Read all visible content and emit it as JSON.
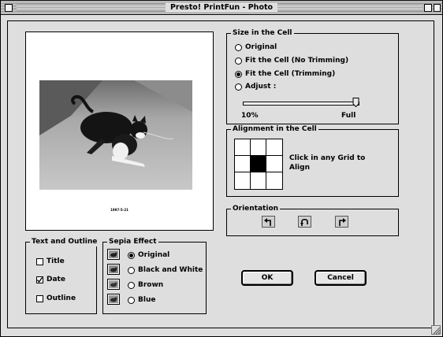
{
  "window": {
    "title": "Presto! PrintFun - Photo"
  },
  "preview": {
    "caption": "1997-5-21"
  },
  "size_in_cell": {
    "legend": "Size in the Cell",
    "options": [
      "Original",
      "Fit the Cell  (No Trimming)",
      "Fit the Cell  (Trimming)",
      "Adjust :"
    ],
    "selected": "Fit the Cell  (Trimming)",
    "slider": {
      "min_label": "10%",
      "max_label": "Full",
      "value_fraction": 1.0
    }
  },
  "alignment": {
    "legend": "Alignment in the Cell",
    "hint": "Click in any Grid to Align",
    "selected_cell": "center"
  },
  "orientation": {
    "legend": "Orientation",
    "buttons": [
      "rotate-left-icon",
      "rotate-180-icon",
      "rotate-right-icon"
    ]
  },
  "text_outline": {
    "legend": "Text and Outline",
    "items": [
      {
        "label": "Title",
        "checked": false
      },
      {
        "label": "Date",
        "checked": true
      },
      {
        "label": "Outline",
        "checked": false
      }
    ]
  },
  "sepia": {
    "legend": "Sepia Effect",
    "options": [
      "Original",
      "Black and White",
      "Brown",
      "Blue"
    ],
    "selected": "Original"
  },
  "buttons": {
    "ok": "OK",
    "cancel": "Cancel"
  }
}
